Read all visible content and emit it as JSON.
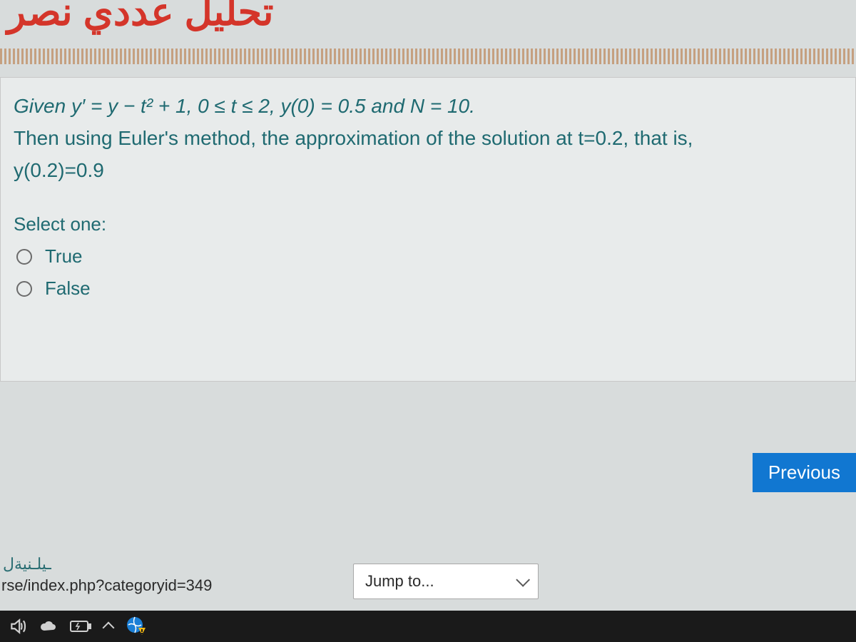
{
  "header": {
    "arabic_text": "تحليل عددي نصر"
  },
  "question": {
    "line1_prefix": "Given ",
    "line1_math": "y′ = y − t² + 1, 0 ≤ t ≤ 2, y(0) = 0.5 and N = 10.",
    "line2": "Then using Euler's method, the approximation of the solution at t=0.2, that is,",
    "line3": "y(0.2)=0.9",
    "select_label": "Select one:",
    "options": [
      {
        "label": "True"
      },
      {
        "label": "False"
      }
    ]
  },
  "nav": {
    "previous_label": "Previous",
    "jump_label": "Jump to..."
  },
  "footer": {
    "arabic_small": "ـيلـنيةل",
    "url_fragment": "rse/index.php?categoryid=349"
  }
}
